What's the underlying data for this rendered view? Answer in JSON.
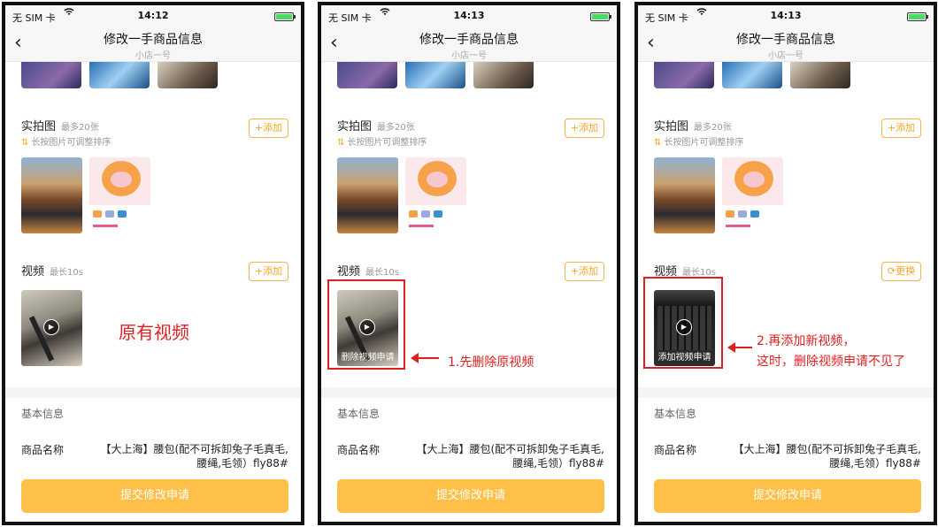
{
  "status": {
    "carrier": "无 SIM 卡",
    "wifi_icon": "wifi-icon",
    "battery_icon": "battery-icon"
  },
  "screens": [
    {
      "time": "14:12",
      "video_button": "+添加",
      "video_caption": ""
    },
    {
      "time": "14:13",
      "video_button": "+添加",
      "video_caption": "删除视频申请"
    },
    {
      "time": "14:13",
      "video_button": "⟳更换",
      "video_caption": "添加视频申请"
    }
  ],
  "nav": {
    "title": "修改一手商品信息",
    "subtitle": "小店一号",
    "back_icon": "chevron-left-icon"
  },
  "photos_section": {
    "title": "实拍图",
    "hint": "最多20张",
    "sort_hint": "长按图片可调整排序",
    "add_label": "+添加"
  },
  "video_section": {
    "title": "视频",
    "hint": "最长10s"
  },
  "basic_info": {
    "title": "基本信息",
    "product_label": "商品名称",
    "product_value": "【大上海】腰包(配不可拆卸兔子毛真毛,腰绳,毛领）fly88#"
  },
  "submit_label": "提交修改申请",
  "annotations": {
    "original_video": "原有视频",
    "step1": "1.先删除原视频",
    "step2_line1": "2.再添加新视频，",
    "step2_line2": "这时，删除视频申请不见了"
  },
  "colors": {
    "accent": "#f5a623",
    "submit_bg": "#ffc04a",
    "annotation_red": "#e02020"
  }
}
